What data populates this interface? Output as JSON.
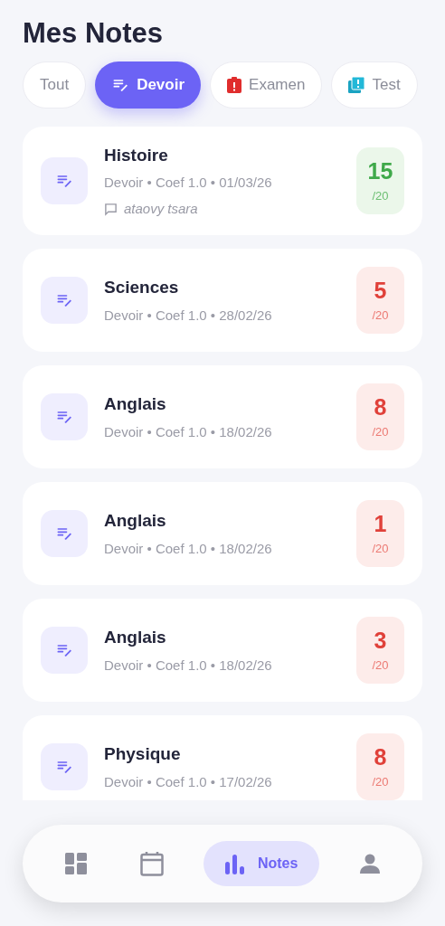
{
  "title": "Mes Notes",
  "filters": [
    {
      "label": "Tout",
      "kind": "none",
      "selected": false
    },
    {
      "label": "Devoir",
      "kind": "devoir",
      "selected": true
    },
    {
      "label": "Examen",
      "kind": "examen",
      "selected": false
    },
    {
      "label": "Test",
      "kind": "test",
      "selected": false
    }
  ],
  "grades": [
    {
      "subject": "Histoire",
      "meta": "Devoir • Coef 1.0 • 01/03/26",
      "comment": "ataovy tsara",
      "score": "15",
      "max": "/20",
      "kind": "pass"
    },
    {
      "subject": "Sciences",
      "meta": "Devoir • Coef 1.0 • 28/02/26",
      "score": "5",
      "max": "/20",
      "kind": "fail"
    },
    {
      "subject": "Anglais",
      "meta": "Devoir • Coef 1.0 • 18/02/26",
      "score": "8",
      "max": "/20",
      "kind": "fail"
    },
    {
      "subject": "Anglais",
      "meta": "Devoir • Coef 1.0 • 18/02/26",
      "score": "1",
      "max": "/20",
      "kind": "fail"
    },
    {
      "subject": "Anglais",
      "meta": "Devoir • Coef 1.0 • 18/02/26",
      "score": "3",
      "max": "/20",
      "kind": "fail"
    },
    {
      "subject": "Physique",
      "meta": "Devoir • Coef 1.0 • 17/02/26",
      "score": "8",
      "max": "/20",
      "kind": "fail"
    }
  ],
  "nav": [
    {
      "kind": "dashboard",
      "selected": false
    },
    {
      "kind": "calendar",
      "selected": false
    },
    {
      "kind": "chart",
      "label": "Notes",
      "selected": true
    },
    {
      "kind": "profile",
      "selected": false
    }
  ]
}
